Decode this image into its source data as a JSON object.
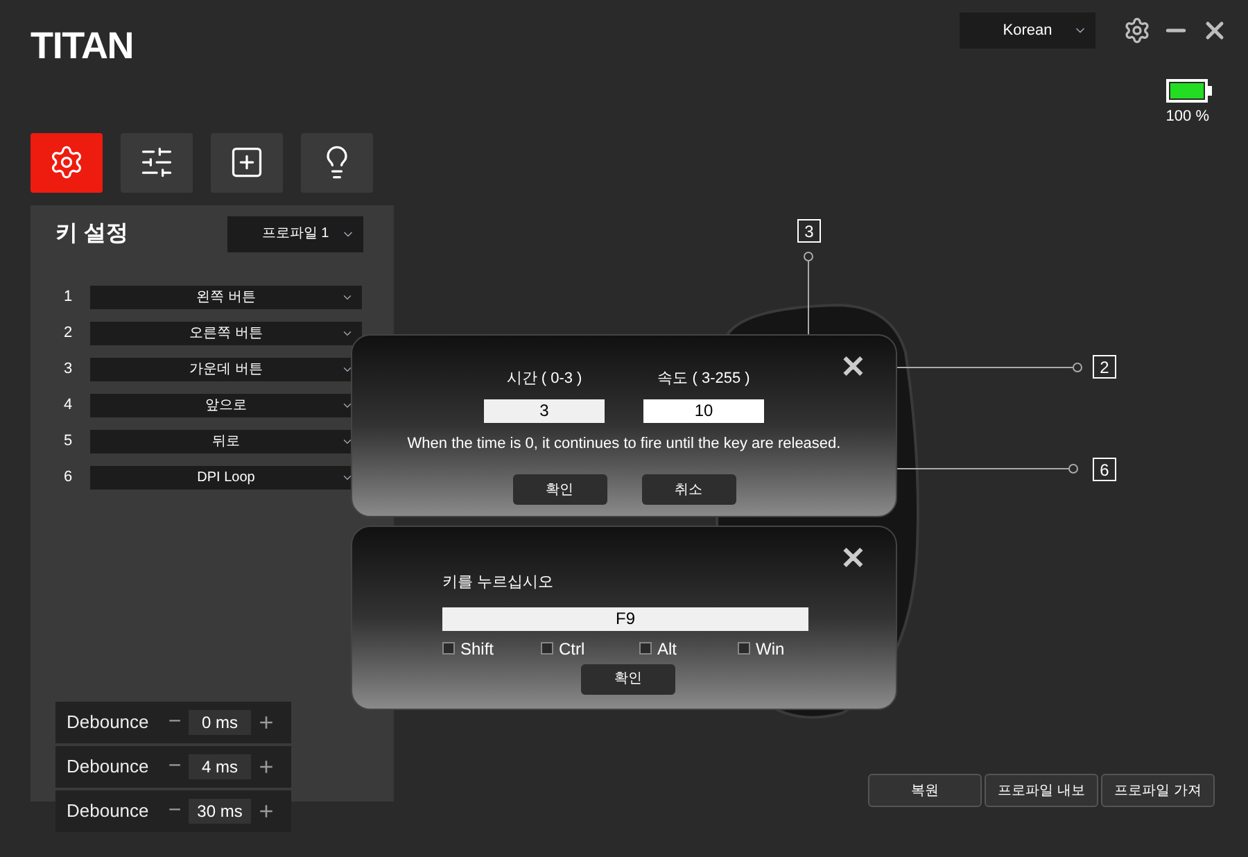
{
  "app": {
    "logo": "TITAN",
    "language": "Korean",
    "battery": {
      "reading": "100 %",
      "level": 1
    }
  },
  "tabs": [
    {
      "selected": true
    },
    {
      "selected": false
    },
    {
      "selected": false
    },
    {
      "selected": false
    }
  ],
  "key_panel": {
    "title": "키 설정",
    "profile": "프로파일 1",
    "buttons": [
      {
        "number": "1",
        "value": "왼쪽 버튼"
      },
      {
        "number": "2",
        "value": "오른쪽 버튼"
      },
      {
        "number": "3",
        "value": "가운데 버튼"
      },
      {
        "number": "4",
        "value": "앞으로"
      },
      {
        "number": "5",
        "value": "뒤로"
      },
      {
        "number": "6",
        "value": "DPI Loop"
      }
    ]
  },
  "debounce": [
    {
      "label": "Debounce",
      "minus": "−",
      "value": "0 ms",
      "plus": "+"
    },
    {
      "label": "Debounce",
      "minus": "−",
      "value": "4 ms",
      "plus": "+"
    },
    {
      "label": "Debounce",
      "minus": "−",
      "value": "30 ms",
      "plus": "+"
    }
  ],
  "callouts": [
    {
      "label": "3"
    },
    {
      "label": "2"
    },
    {
      "label": "6"
    }
  ],
  "fire_dialog": {
    "close": "✕",
    "time_label": "시간 ( 0-3 )",
    "time_value": "3",
    "speed_label": "속도 ( 3-255 )",
    "speed_value": "10",
    "note": "When the time is 0, it continues to fire until the key are released.",
    "buttons": [
      "확인",
      "취소"
    ]
  },
  "key_dialog": {
    "close": "✕",
    "prompt": "키를 누르십시오",
    "value": "F9",
    "modifiers": [
      {
        "label": "Shift",
        "checked": false
      },
      {
        "label": "Ctrl",
        "checked": false
      },
      {
        "label": "Alt",
        "checked": false
      },
      {
        "label": "Win",
        "checked": false
      }
    ],
    "button": "확인"
  },
  "footer_buttons": [
    "복원",
    "프로파일 내보",
    "프로파일 가져"
  ]
}
